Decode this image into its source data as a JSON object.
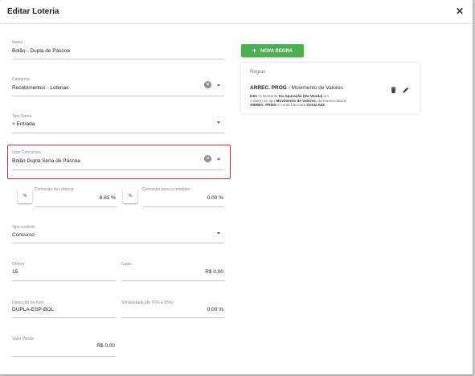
{
  "dialog": {
    "title": "Editar Loteria",
    "close_glyph": "✕"
  },
  "form": {
    "nome": {
      "label": "Nome",
      "value": "Bolão - Dupla de Páscoa"
    },
    "categoria": {
      "label": "Categoria",
      "value": "Recebimentos - Loterias"
    },
    "tipo_soma": {
      "label": "Tipo Soma",
      "value": "+ Entrada"
    },
    "usar_concursos": {
      "label": "Usar Concursos",
      "value": "Bolão Dupla Sena de Páscoa"
    },
    "comissao_loterica": {
      "label": "Comissão da Lotérica",
      "value": "8.61 %",
      "button": "%"
    },
    "comissao_vendedor": {
      "label": "Comissão para o vendedor",
      "value": "0.00 %",
      "button": "%"
    },
    "tipo_controle": {
      "label": "Tipo controle",
      "value": "Concurso"
    },
    "ordem": {
      "label": "Ordem",
      "value": "15"
    },
    "custo": {
      "label": "Custo",
      "value": "R$ 0,00"
    },
    "deteccao_foto": {
      "label": "Detecção na Foto",
      "value": "DUPLA-ESP-BOL"
    },
    "similaridade": {
      "label": "Similaridade (de 70% a 95%)",
      "value": "0.00 %"
    },
    "valor_venda": {
      "label": "Valor Venda",
      "value": "R$ 0,00"
    }
  },
  "rules": {
    "new_button_label": "NOVA REGRA",
    "new_button_glyph": "+",
    "panel_title": "Regras",
    "items": [
      {
        "name": "ARREC. PROG",
        "separator": " - ",
        "type": "Movimento de Valores",
        "line1_value": "8.61",
        "line1_mid": " % Restante ",
        "line1_bold": "Da Apuração (Da Venda)",
        "line1_end": " em",
        "line2_start": "1 dia(s) do tipo ",
        "line2_bold": "Movimento de Valores",
        "line2_end": ", da nomenclatura",
        "line3_bold1": "ARREC. PROG",
        "line3_mid": " e conta bancaria ",
        "line3_bold2": "Conta 043",
        "line3_end": "."
      }
    ]
  },
  "colors": {
    "accent_green": "#4caf50",
    "highlight_red": "#d93030"
  },
  "icons": {
    "clear": "clear-icon",
    "dropdown": "chevron-down-icon",
    "delete": "trash-icon",
    "edit": "pencil-icon",
    "add": "plus-icon"
  }
}
